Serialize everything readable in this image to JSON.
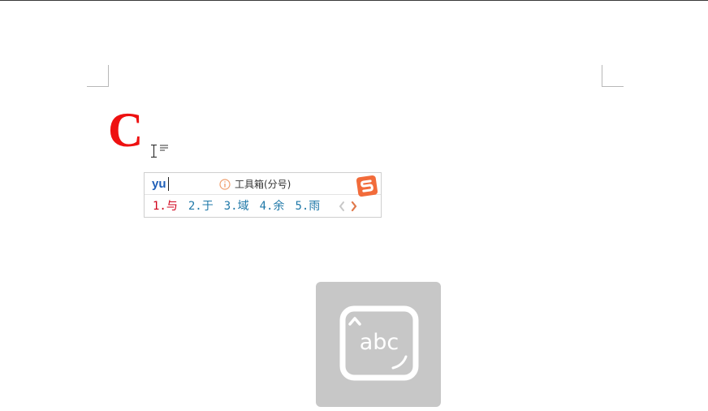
{
  "document": {
    "drop_cap_letter": "C",
    "drop_cap_color": "#ee1111"
  },
  "ime": {
    "pinyin": "yu",
    "toolbox_label": "工具箱(分号)",
    "candidates": [
      {
        "label": "1.与",
        "selected": true
      },
      {
        "label": "2.于",
        "selected": false
      },
      {
        "label": "3.域",
        "selected": false
      },
      {
        "label": "4.余",
        "selected": false
      },
      {
        "label": "5.雨",
        "selected": false
      }
    ],
    "icons": {
      "info": "info-icon",
      "logo": "sogou-logo-icon",
      "prev": "chevron-left-icon",
      "next": "chevron-right-icon"
    },
    "colors": {
      "pinyin": "#1f5fb8",
      "candidate": "#1f78a8",
      "selected_candidate": "#d0021b",
      "logo": "#f26b3a"
    }
  },
  "input_mode_tile": {
    "label": "abc",
    "icon": "keyboard-abc-icon",
    "background": "#c7c7c7"
  }
}
